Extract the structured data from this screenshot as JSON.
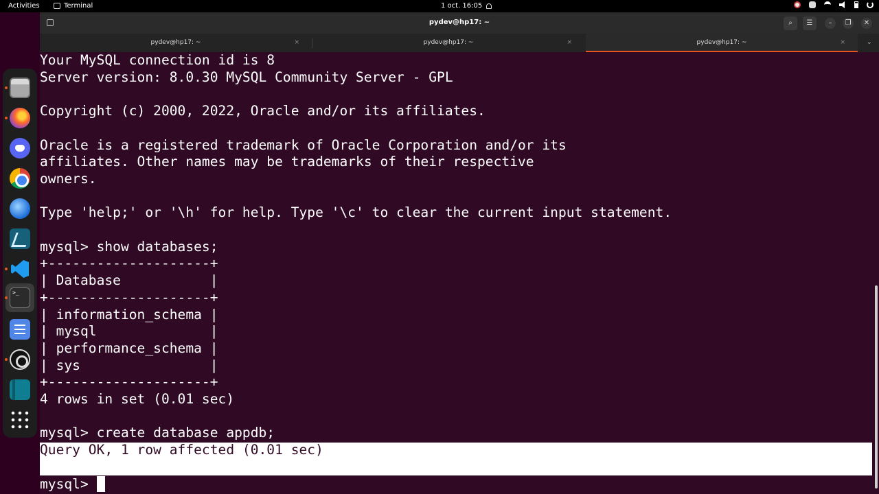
{
  "topbar": {
    "activities": "Activities",
    "app_name": "Terminal",
    "clock": "1 oct.  16:05",
    "tray_icons": [
      "chrome-icon",
      "discord-icon",
      "wifi-icon",
      "volume-icon",
      "battery-icon",
      "power-icon"
    ]
  },
  "dock": {
    "apps": [
      "files",
      "firefox",
      "discord",
      "chrome",
      "thunderbird",
      "mysql-workbench",
      "vscode",
      "terminal",
      "tasks",
      "obs-studio",
      "book-reader",
      "show-applications"
    ]
  },
  "window": {
    "title": "pydev@hp17: ~",
    "tabs": [
      {
        "label": "pydev@hp17: ~",
        "active": false
      },
      {
        "label": "pydev@hp17: ~",
        "active": false
      },
      {
        "label": "pydev@hp17: ~",
        "active": true
      }
    ],
    "tab_close": "×",
    "colors": {
      "terminal_bg": "#300a24",
      "accent": "#e95420"
    }
  },
  "terminal": {
    "lines": [
      "Your MySQL connection id is 8",
      "Server version: 8.0.30 MySQL Community Server - GPL",
      "",
      "Copyright (c) 2000, 2022, Oracle and/or its affiliates.",
      "",
      "Oracle is a registered trademark of Oracle Corporation and/or its",
      "affiliates. Other names may be trademarks of their respective",
      "owners.",
      "",
      "Type 'help;' or '\\h' for help. Type '\\c' to clear the current input statement.",
      "",
      "mysql> show databases;",
      "+--------------------+",
      "| Database           |",
      "+--------------------+",
      "| information_schema |",
      "| mysql              |",
      "| performance_schema |",
      "| sys                |",
      "+--------------------+",
      "4 rows in set (0.01 sec)",
      "",
      "mysql> create database appdb;",
      "Query OK, 1 row affected (0.01 sec)",
      "",
      "mysql>"
    ]
  }
}
